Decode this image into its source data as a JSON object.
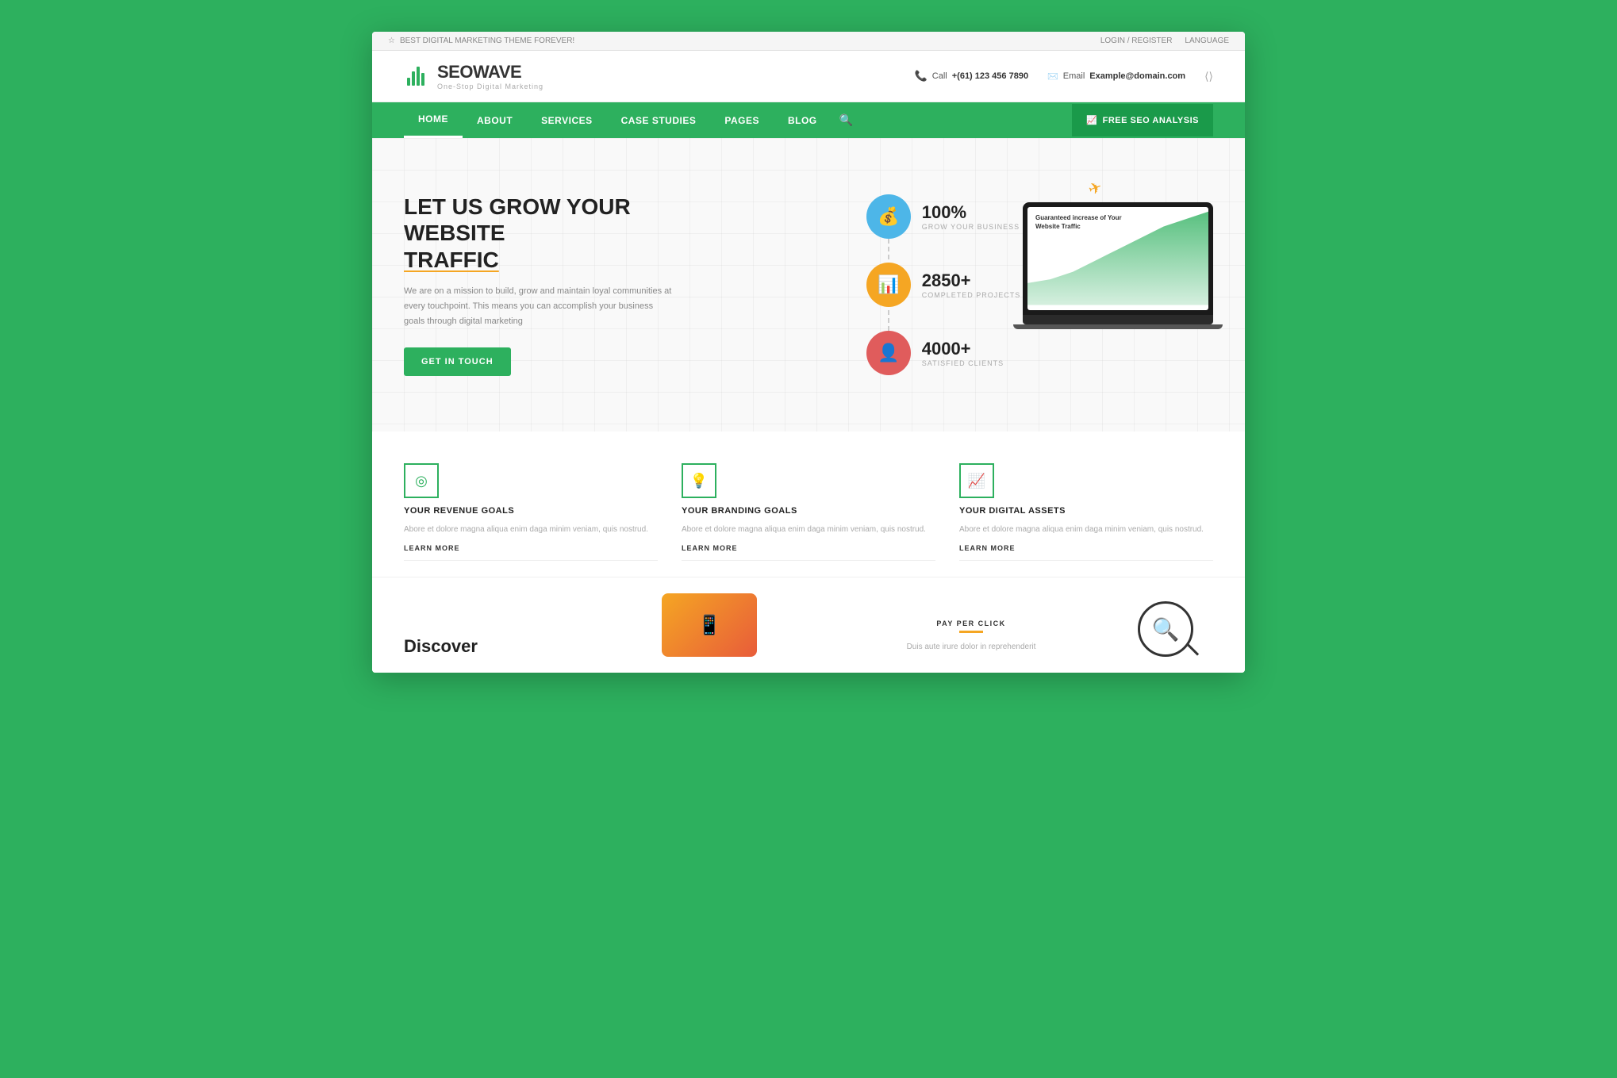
{
  "topbar": {
    "left_text": "BEST DIGITAL MARKETING THEME FOREVER!",
    "login_label": "LOGIN / REGISTER",
    "language_label": "LANGUAGE"
  },
  "header": {
    "logo_seo": "SEO",
    "logo_wave": "WAVE",
    "logo_tagline": "One-Stop Digital Marketing",
    "call_label": "Call",
    "call_number": "+(61) 123 456 7890",
    "email_label": "Email",
    "email_value": "Example@domain.com"
  },
  "nav": {
    "items": [
      {
        "label": "HOME",
        "active": true
      },
      {
        "label": "ABOUT",
        "active": false
      },
      {
        "label": "SERVICES",
        "active": false
      },
      {
        "label": "CASE STUDIES",
        "active": false
      },
      {
        "label": "PAGES",
        "active": false
      },
      {
        "label": "BLOG",
        "active": false
      }
    ],
    "cta_label": "FREE SEO ANALYSIS"
  },
  "hero": {
    "title_line1": "LET US GROW YOUR WEBSITE",
    "title_line2": "TRAFFIC",
    "description": "We are on a mission to build, grow and maintain loyal communities at every touchpoint. This means you can accomplish your business goals through digital marketing",
    "cta_button": "GET IN TOUCH",
    "stats": [
      {
        "icon": "💰",
        "color": "blue",
        "number": "100%",
        "label": "GROW YOUR BUSINESS"
      },
      {
        "icon": "📊",
        "color": "yellow",
        "number": "2850+",
        "label": "COMPLETED PROJECTS"
      },
      {
        "icon": "👤",
        "color": "red",
        "number": "4000+",
        "label": "SATISFIED CLIENTS"
      }
    ],
    "laptop": {
      "chart_label": "Guaranteed increase of Your\nWebsite Traffic"
    }
  },
  "services": {
    "items": [
      {
        "icon": "◎",
        "title": "YOUR REVENUE GOALS",
        "desc": "Abore et dolore magna aliqua enim daga minim veniam, quis nostrud.",
        "link": "LEARN MORE"
      },
      {
        "icon": "💡",
        "title": "YOUR BRANDING GOALS",
        "desc": "Abore et dolore magna aliqua enim daga minim veniam, quis nostrud.",
        "link": "LEARN MORE"
      },
      {
        "icon": "📈",
        "title": "YOUR DIGITAL ASSETS",
        "desc": "Abore et dolore magna aliqua enim daga minim veniam, quis nostrud.",
        "link": "LEARN MORE"
      }
    ]
  },
  "bottom": {
    "discover_title": "Discover",
    "ppc_label": "PAY PER CLICK",
    "ppc_desc": "Duis aute irure dolor in reprehenderit"
  }
}
